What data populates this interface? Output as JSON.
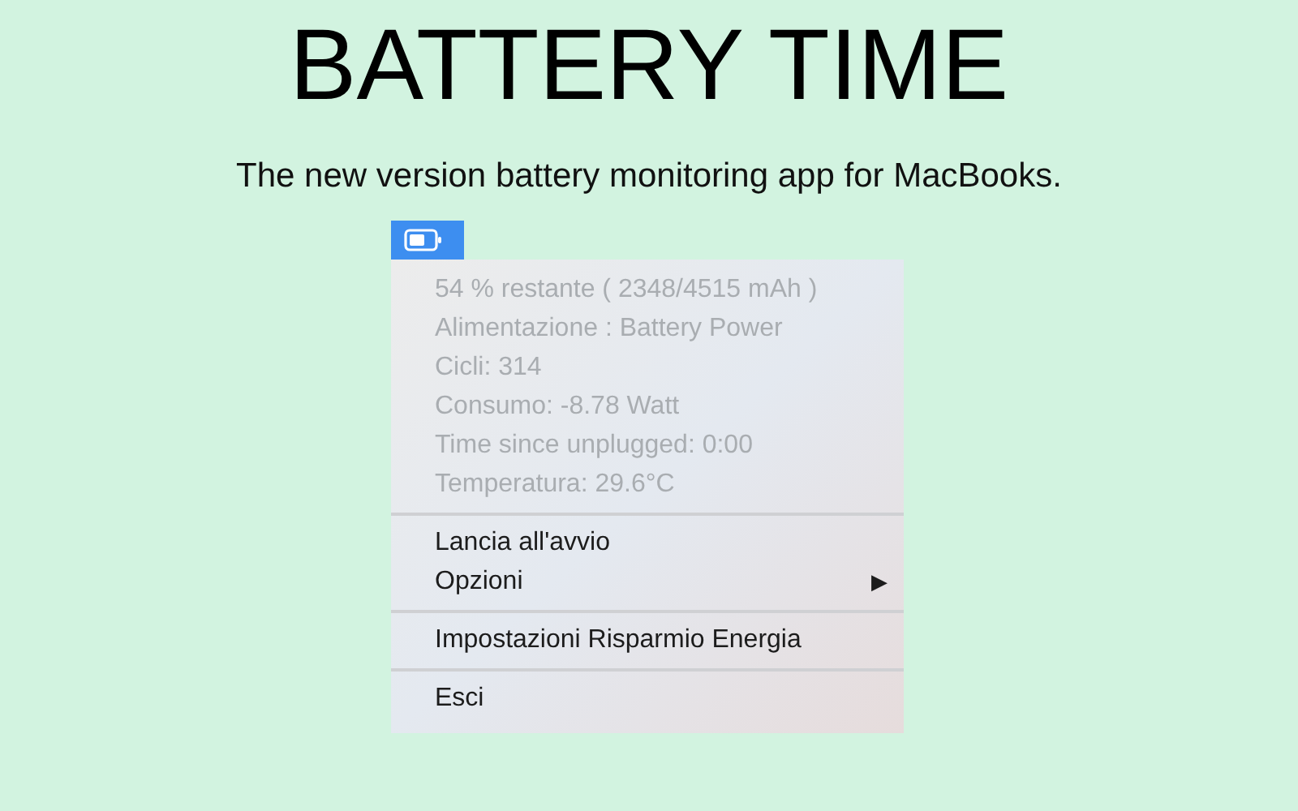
{
  "title": "BATTERY TIME",
  "subtitle": "The new version battery monitoring app for MacBooks.",
  "menu_bar": {
    "selected": true
  },
  "menu": {
    "sections": [
      {
        "items": [
          {
            "label": "54 % restante ( 2348/4515 mAh )",
            "disabled": true
          },
          {
            "label": "Alimentazione : Battery Power",
            "disabled": true
          },
          {
            "label": "Cicli: 314",
            "disabled": true
          },
          {
            "label": "Consumo: -8.78 Watt",
            "disabled": true
          },
          {
            "label": "Time since unplugged: 0:00",
            "disabled": true
          },
          {
            "label": "Temperatura: 29.6°C",
            "disabled": true
          }
        ]
      },
      {
        "items": [
          {
            "label": "Lancia all'avvio",
            "disabled": false
          },
          {
            "label": "Opzioni",
            "disabled": false,
            "submenu": "▶"
          }
        ]
      },
      {
        "items": [
          {
            "label": "Impostazioni Risparmio Energia",
            "disabled": false
          }
        ]
      },
      {
        "items": [
          {
            "label": "Esci",
            "disabled": false
          }
        ]
      }
    ]
  }
}
